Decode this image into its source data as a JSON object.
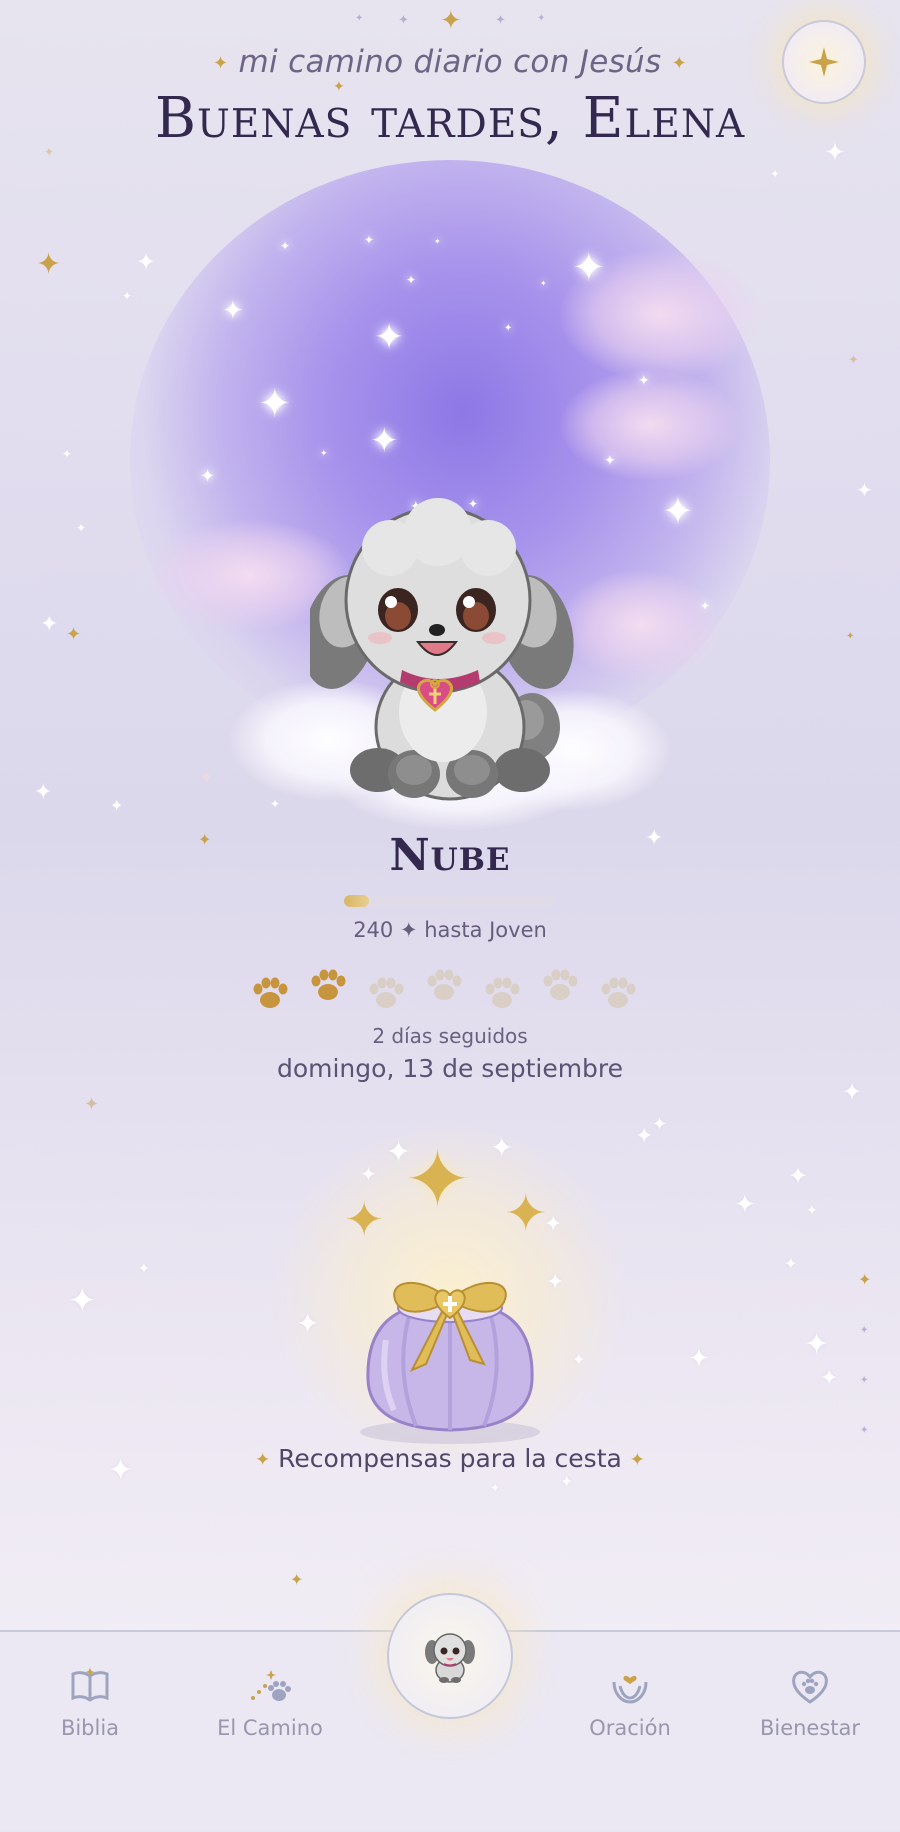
{
  "header": {
    "subtitle": "mi camino diario con Jesús",
    "greeting": "Buenas tardes, Elena",
    "sparkle_glyph": "✦"
  },
  "top_button": {
    "icon": "sparkle-icon"
  },
  "pet": {
    "name": "Nube",
    "progress_fraction": 0.12,
    "progress_label": "240 ✦ hasta Joven",
    "streak_label": "2 días seguidos",
    "date_label": "domingo, 13 de septiembre",
    "streak_days": [
      {
        "filled": true
      },
      {
        "filled": true
      },
      {
        "filled": false
      },
      {
        "filled": false
      },
      {
        "filled": false
      },
      {
        "filled": false
      },
      {
        "filled": false
      }
    ]
  },
  "rewards": {
    "label": "Recompensas para la cesta"
  },
  "nav": {
    "items": [
      {
        "label": "Biblia",
        "icon": "book-icon"
      },
      {
        "label": "El Camino",
        "icon": "paw-trail-icon"
      },
      {
        "label": "Oración",
        "icon": "praying-hands-icon"
      },
      {
        "label": "Bienestar",
        "icon": "heart-paw-icon"
      }
    ],
    "home_icon": "puppy-avatar-icon"
  },
  "colors": {
    "gold": "#c9a24a",
    "title": "#33294f",
    "nav_label": "#9a96ae",
    "paw_filled": "#c8953f",
    "paw_empty": "#d9cfc6"
  }
}
